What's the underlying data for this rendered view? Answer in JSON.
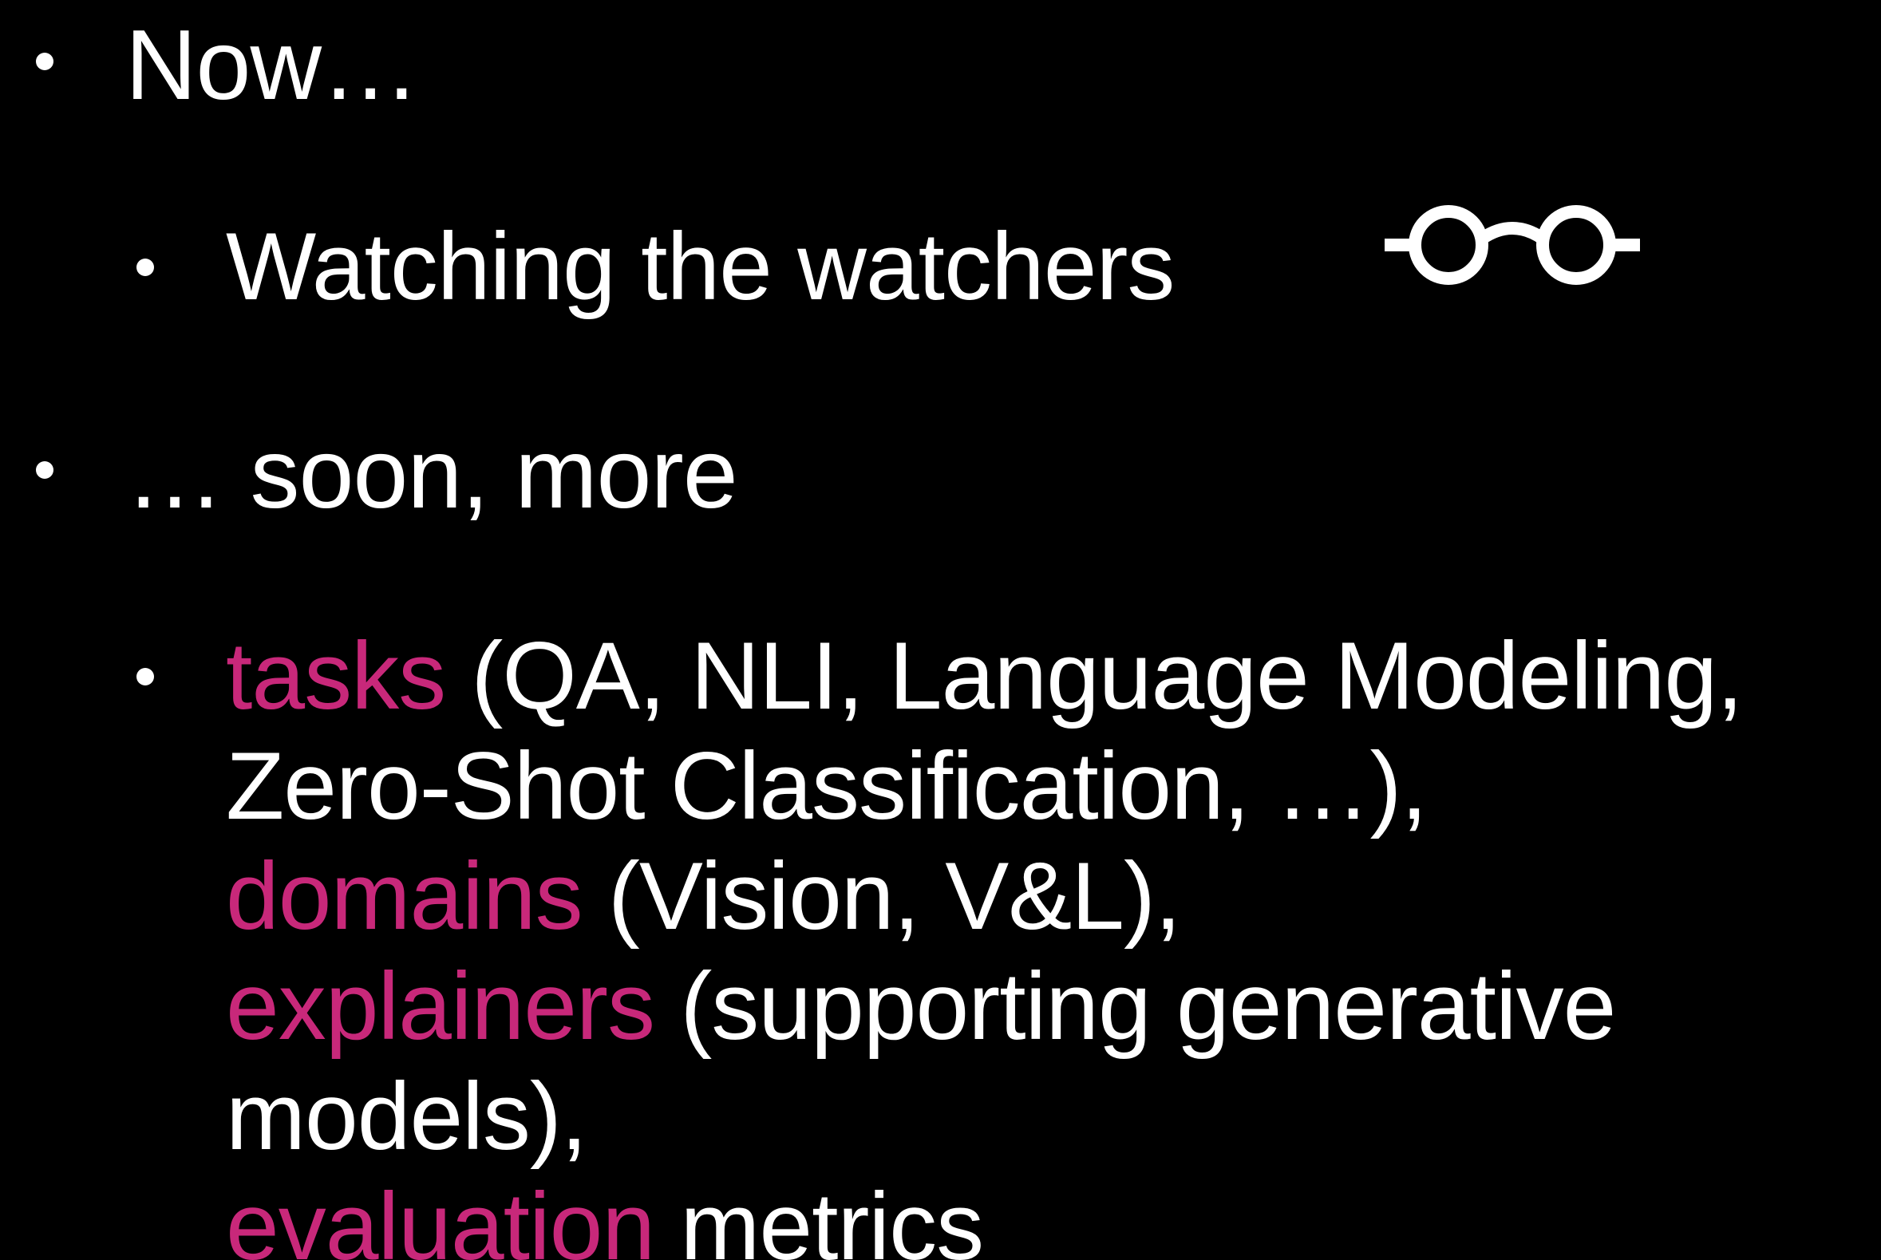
{
  "colors": {
    "background": "#000000",
    "text": "#ffffff",
    "accent": "#c8287a"
  },
  "bullets": {
    "now": {
      "text": "Now…"
    },
    "watching": {
      "text": "Watching the watchers",
      "icon": "glasses-icon"
    },
    "soon": {
      "text": "… soon, more"
    },
    "more": {
      "tasks_keyword": "tasks",
      "tasks_rest": " (QA, NLI, Language Modeling,",
      "line2": "Zero-Shot Classification, …),",
      "domains_keyword": "domains",
      "domains_rest": " (Vision, V&L),",
      "explainers_keyword": "explainers",
      "explainers_rest": " (supporting generative",
      "line5": "models),",
      "evaluation_keyword": "evaluation",
      "evaluation_rest": " metrics"
    }
  }
}
